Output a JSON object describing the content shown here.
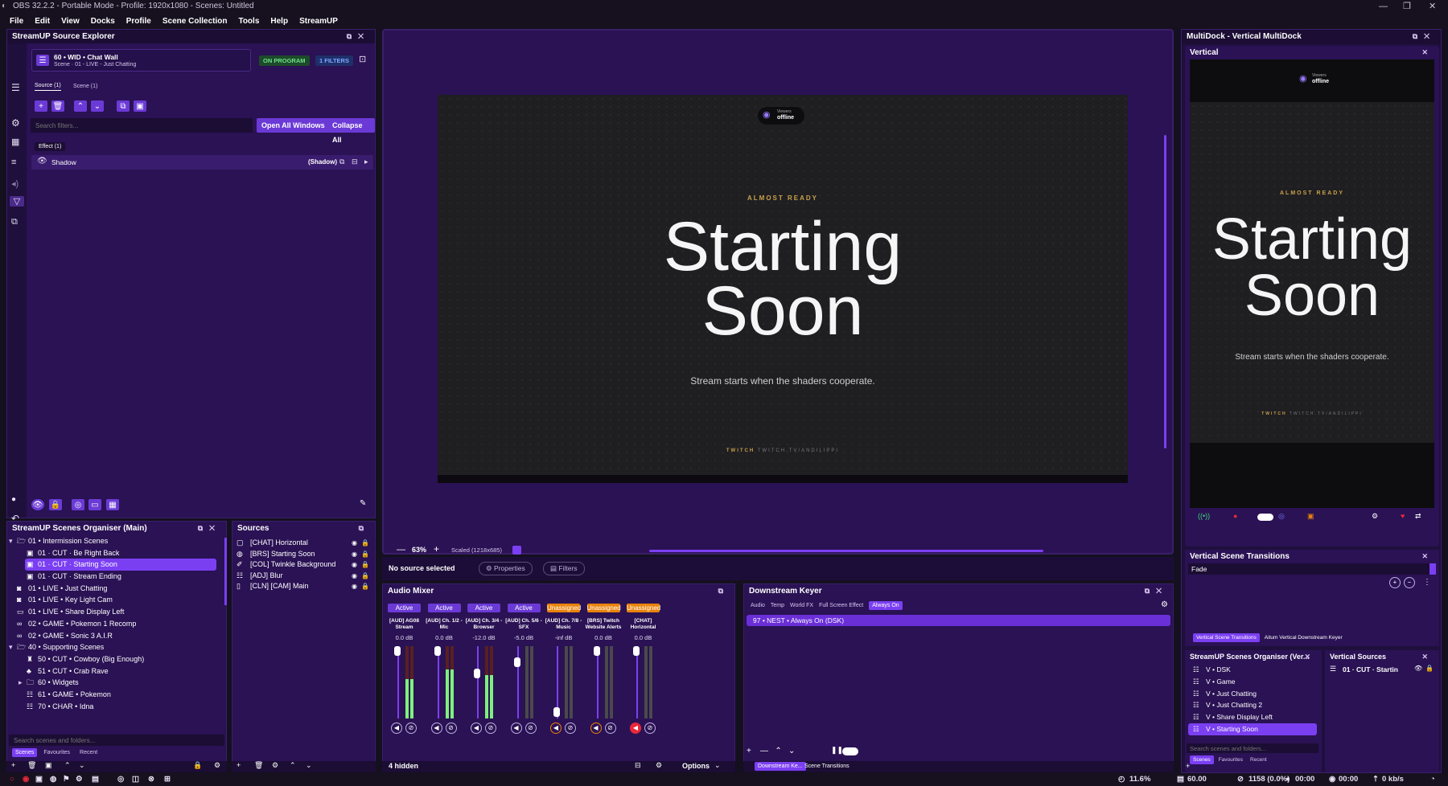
{
  "window": {
    "title": "OBS 32.2.2 - Portable Mode - Profile: 1920x1080 - Scenes: Untitled"
  },
  "menu": [
    "File",
    "Edit",
    "View",
    "Docks",
    "Profile",
    "Scene Collection",
    "Tools",
    "Help",
    "StreamUP"
  ],
  "source_explorer": {
    "title": "StreamUP Source Explorer",
    "source_name": "60 • WID • Chat Wall",
    "source_sub": "Scene · 01 - LIVE - Just Chatting",
    "on_program": "ON PROGRAM",
    "filters_badge": "1 FILTERS",
    "tab_source": "Source (1)",
    "tab_scene": "Scene (1)",
    "search_placeholder": "Search filters...",
    "open_all": "Open All Windows",
    "collapse_all": "Collapse All",
    "effect_tab": "Effect (1)",
    "filter_name": "Shadow",
    "filter_type": "(Shadow)"
  },
  "preview": {
    "viewers_label": "Viewers",
    "viewers_status": "offline",
    "almost_ready": "ALMOST READY",
    "starting": "Starting",
    "soon": "Soon",
    "tagline": "Stream starts when the shaders cooperate.",
    "twitch": "TWITCH",
    "twitch_url": "TWITCH.TV/ANDILIPPI",
    "zoom": "63%",
    "scaled": "Scaled (1218x685)"
  },
  "context_bar": {
    "no_source": "No source selected",
    "properties": "Properties",
    "filters": "Filters"
  },
  "scenes_organiser": {
    "title": "StreamUP Scenes Organiser (Main)",
    "items": [
      {
        "label": "01 • Intermission Scenes",
        "indent": 0,
        "type": "folder-open",
        "expand": "▾"
      },
      {
        "label": "01 · CUT · Be Right Back",
        "indent": 1,
        "type": "scene"
      },
      {
        "label": "01 · CUT · Starting Soon",
        "indent": 1,
        "type": "scene",
        "selected": true
      },
      {
        "label": "01 · CUT · Stream Ending",
        "indent": 1,
        "type": "scene"
      },
      {
        "label": "01 • LIVE • Just Chatting",
        "indent": 0,
        "type": "camera"
      },
      {
        "label": "01 • LIVE • Key Light Cam",
        "indent": 0,
        "type": "camera"
      },
      {
        "label": "01 • LIVE • Share Display Left",
        "indent": 0,
        "type": "display"
      },
      {
        "label": "02 • GAME • Pokemon 1 Recomp",
        "indent": 0,
        "type": "game"
      },
      {
        "label": "02 • GAME • Sonic 3 A.I.R",
        "indent": 0,
        "type": "game"
      },
      {
        "label": "40 • Supporting Scenes",
        "indent": 0,
        "type": "folder-open",
        "expand": "▾"
      },
      {
        "label": "50 • CUT • Cowboy (Big Enough)",
        "indent": 1,
        "type": "cowboy"
      },
      {
        "label": "51 • CUT • Crab Rave",
        "indent": 1,
        "type": "crab"
      },
      {
        "label": "60 • Widgets",
        "indent": 1,
        "type": "folder",
        "expand": "▸"
      },
      {
        "label": "61 • GAME • Pokemon",
        "indent": 1,
        "type": "list"
      },
      {
        "label": "70 • CHAR • Idna",
        "indent": 1,
        "type": "list"
      }
    ],
    "search_placeholder": "Search scenes and folders...",
    "tabs": [
      "Scenes",
      "Favourites",
      "Recent"
    ]
  },
  "sources": {
    "title": "Sources",
    "items": [
      {
        "label": "[CHAT] Horizontal",
        "icon": "chat"
      },
      {
        "label": "[BRS] Starting Soon",
        "icon": "globe"
      },
      {
        "label": "[COL] Twinkle Background",
        "icon": "brush"
      },
      {
        "label": "[ADJ] Blur",
        "icon": "list"
      },
      {
        "label": "[CLN] [CAM] Main",
        "icon": "file"
      }
    ]
  },
  "audio_mixer": {
    "title": "Audio Mixer",
    "channels": [
      {
        "status": "Active",
        "name": "[AUD] AG08 Stream",
        "db": "0.0 dB",
        "level": 0.55,
        "muted": false
      },
      {
        "status": "Active",
        "name": "[AUD] Ch. 1/2 - Mic",
        "db": "0.0 dB",
        "level": 0.68,
        "muted": false
      },
      {
        "status": "Active",
        "name": "[AUD] Ch. 3/4 - Browser",
        "db": "-12.0 dB",
        "level": 0.6,
        "muted": false
      },
      {
        "status": "Active",
        "name": "[AUD] Ch. 5/6 - SFX",
        "db": "-5.0 dB",
        "level": 0.0,
        "muted": false
      },
      {
        "status": "Unassigned",
        "name": "[AUD] Ch. 7/8 - Music",
        "db": "-inf dB",
        "level": 0.0,
        "muted": false
      },
      {
        "status": "Unassigned",
        "name": "[BRS] Twitch Website Alerts",
        "db": "0.0 dB",
        "level": 0.0,
        "muted": false
      },
      {
        "status": "Unassigned",
        "name": "[CHAT] Horizontal",
        "db": "0.0 dB",
        "level": 0.0,
        "muted": true
      }
    ],
    "hidden": "4 hidden",
    "options": "Options"
  },
  "downstream_keyer": {
    "title": "Downstream Keyer",
    "tabs": [
      "Audio",
      "Temp",
      "World FX",
      "Full Screen Effect",
      "Always On"
    ],
    "item": "97 • NEST • Always On (DSK)"
  },
  "bottom_tabs": [
    "Downstream Ke...",
    "Scene Transitions"
  ],
  "multidock": {
    "title": "MultiDock - Vertical MultiDock",
    "vertical_title": "Vertical",
    "transitions_title": "Vertical Scene Transitions",
    "transition": "Fade",
    "tabs": [
      "Vertical Scene Transitions",
      "Aitum Vertical Downstream Keyer"
    ],
    "organiser_title": "StreamUP Scenes Organiser (Ver...",
    "organiser_items": [
      "V • DSK",
      "V • Game",
      "V • Just Chatting",
      "V • Just Chatting 2",
      "V • Share Display Left",
      "V • Starting Soon"
    ],
    "organiser_search": "Search scenes and folders...",
    "organiser_tabs": [
      "Scenes",
      "Favourites",
      "Recent"
    ],
    "sources_title": "Vertical Sources",
    "sources_item": "01 · CUT · Startin"
  },
  "status_bar": {
    "cpu": "11.6%",
    "fps": "60.00",
    "dropped": "1158 (0.0%)",
    "rec_time": "00:00",
    "stream_time": "00:00",
    "bitrate": "0 kb/s"
  },
  "colors": {
    "accent": "#7b3ff2",
    "panel": "#2a1254",
    "active": "#6b3ad6",
    "unassigned": "#e8820c",
    "gold": "#c9a24a"
  }
}
